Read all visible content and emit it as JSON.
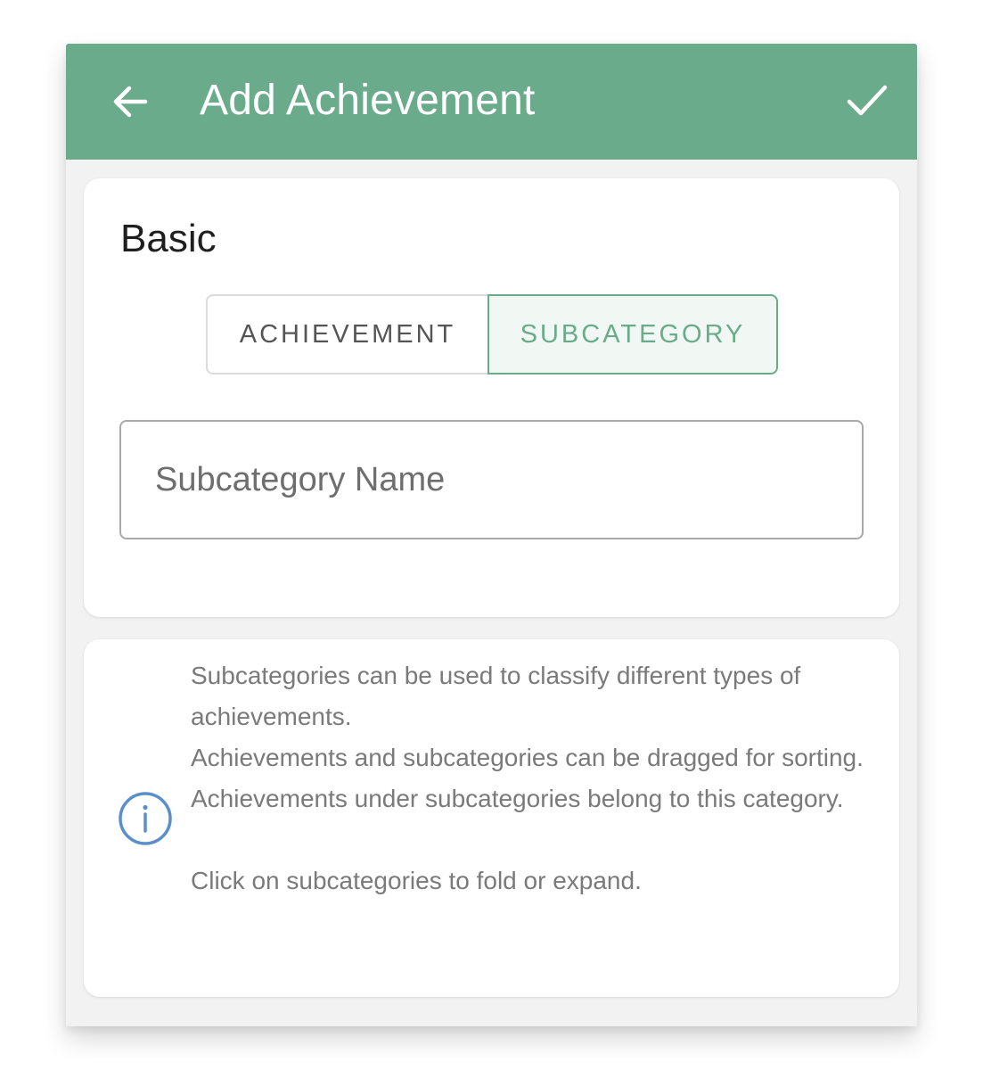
{
  "app_bar": {
    "title": "Add Achievement",
    "back_icon": "arrow-left-icon",
    "confirm_icon": "check-icon",
    "color": "#6aab8b"
  },
  "basic_card": {
    "section_title": "Basic",
    "segments": [
      {
        "label": "ACHIEVEMENT",
        "selected": false
      },
      {
        "label": "SUBCATEGORY",
        "selected": true
      }
    ],
    "name_input": {
      "placeholder": "Subcategory Name",
      "value": ""
    }
  },
  "info_card": {
    "icon": "info-icon",
    "icon_color": "#5b8fc9",
    "lines": [
      "Subcategories can be used to classify different types of achievements.",
      "Achievements and subcategories can be dragged for sorting.",
      "Achievements under subcategories belong to this category."
    ],
    "footer": "Click on subcategories to fold or expand."
  }
}
